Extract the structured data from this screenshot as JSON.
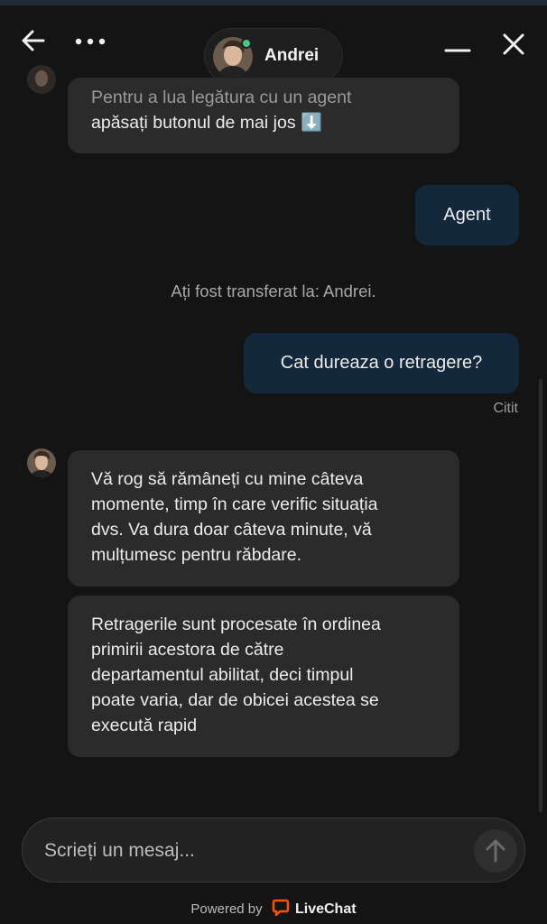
{
  "header": {
    "agent_name": "Andrei",
    "status_color": "#42c97d"
  },
  "messages": {
    "agent_prompt": {
      "line1": "Pentru a lua legătura cu un agent",
      "line2": "apăsați butonul de mai jos",
      "emoji": "⬇️"
    },
    "user_agent": "Agent",
    "system_transfer": "Ați fost transferat la: Andrei.",
    "user_question": "Cat dureaza o retragere?",
    "read_status": "Citit",
    "agent_reply_1": [
      "Vă rog să rămâneți cu mine câteva",
      "momente, timp în care verific situația",
      "dvs. Va dura doar câteva minute, vă",
      "mulțumesc pentru răbdare."
    ],
    "agent_reply_2": [
      "Retragerile sunt procesate în ordinea",
      "primirii acestora de către",
      "departamentul abilitat, deci timpul",
      "poate varia, dar de obicei acestea se",
      "execută rapid"
    ]
  },
  "composer": {
    "placeholder": "Scrieți un mesaj..."
  },
  "footer": {
    "powered_by": "Powered by",
    "brand": "LiveChat",
    "brand_color": "#ff5100"
  },
  "icons": [
    "back-arrow-icon",
    "more-dots-icon",
    "minimize-icon",
    "close-icon",
    "send-arrow-icon",
    "livechat-logo-icon"
  ]
}
